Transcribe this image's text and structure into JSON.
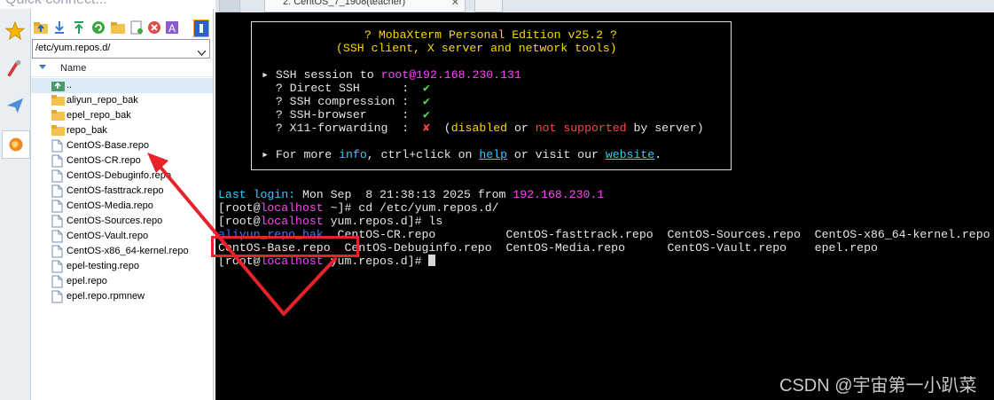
{
  "quick_connect": {
    "placeholder": "Quick connect..."
  },
  "tabs": [
    {
      "label": "2. CentOS_7_1908(teacher)"
    }
  ],
  "file_panel": {
    "path": "/etc/yum.repos.d/",
    "column_header": "Name",
    "rows": [
      {
        "name": "..",
        "type": "parent"
      },
      {
        "name": "aliyun_repo_bak",
        "type": "folder"
      },
      {
        "name": "epel_repo_bak",
        "type": "folder"
      },
      {
        "name": "repo_bak",
        "type": "folder"
      },
      {
        "name": "CentOS-Base.repo",
        "type": "file"
      },
      {
        "name": "CentOS-CR.repo",
        "type": "file"
      },
      {
        "name": "CentOS-Debuginfo.repo",
        "type": "file"
      },
      {
        "name": "CentOS-fasttrack.repo",
        "type": "file"
      },
      {
        "name": "CentOS-Media.repo",
        "type": "file"
      },
      {
        "name": "CentOS-Sources.repo",
        "type": "file"
      },
      {
        "name": "CentOS-Vault.repo",
        "type": "file"
      },
      {
        "name": "CentOS-x86_64-kernel.repo",
        "type": "file"
      },
      {
        "name": "epel-testing.repo",
        "type": "file"
      },
      {
        "name": "epel.repo",
        "type": "file"
      },
      {
        "name": "epel.repo.rpmnew",
        "type": "file"
      }
    ]
  },
  "terminal": {
    "banner": {
      "title": "? MobaXterm Personal Edition v25.2 ?",
      "subtitle": "(SSH client, X server and network tools)",
      "session_prefix": "▸ SSH session to ",
      "session_target": "root@192.168.230.131",
      "direct_ssh": "  ? Direct SSH      :  ",
      "compression": "  ? SSH compression :  ",
      "browser": "  ? SSH-browser     :  ",
      "x11": "  ? X11-forwarding  :  ",
      "check": "✔",
      "cross": "✘",
      "x11_note_open": "  (",
      "disabled": "disabled",
      "or": " or ",
      "not_supported": "not supported",
      "by_server": " by server)",
      "more_prefix": "▸ For more ",
      "info": "info",
      "more_mid": ", ctrl+click on ",
      "help": "help",
      "more_mid2": " or visit our ",
      "website": "website",
      "more_end": "."
    },
    "last_login_label": "Last login:",
    "last_login_date": " Mon Sep  8 21:38:13 2025 from ",
    "last_login_ip": "192.168.230.1",
    "prompt_open": "[root@",
    "prompt_host": "localhost",
    "line1_rest": " ~]# cd /etc/yum.repos.d/",
    "line2_rest": " yum.repos.d]# ls",
    "line3_rest": " yum.repos.d]# ",
    "ls_row1": [
      {
        "text": "aliyun_repo_bak",
        "color": "#3b78ff"
      },
      {
        "text": "  CentOS-CR.repo          CentOS-fasttrack.repo  CentOS-Sources.repo  CentOS-x86_64-kernel.repo",
        "color": "#e6e6e6"
      }
    ],
    "ls_row2": "CentOS-Base.repo  CentOS-Debuginfo.repo  CentOS-Media.repo      CentOS-Vault.repo    epel.repo"
  },
  "watermark": "CSDN @宇宙第一小趴菜",
  "colors": {
    "highlight_red": "#e8222a",
    "terminal_bg": "#000000",
    "host_magenta": "#ff44ff"
  }
}
